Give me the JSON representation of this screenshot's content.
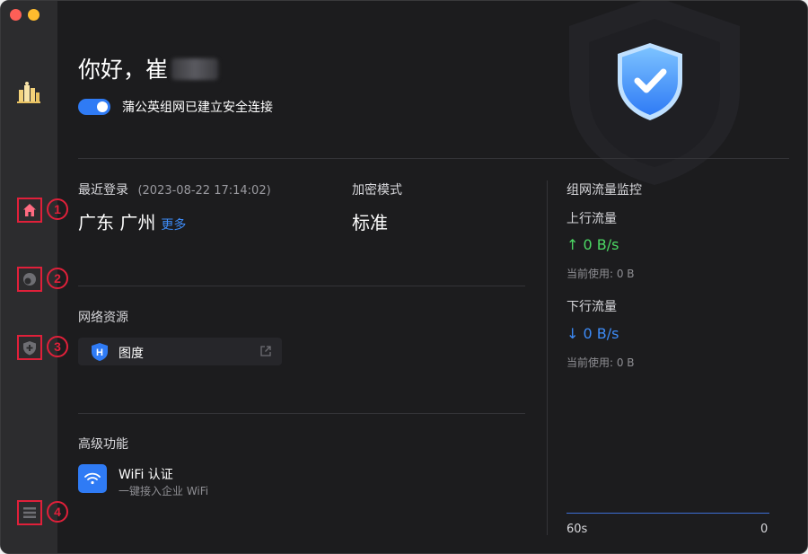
{
  "window": {
    "traffic_lights": [
      "red",
      "yellow"
    ]
  },
  "sidebar": {
    "items": [
      {
        "name": "home",
        "icon": "home-icon",
        "num": "1"
      },
      {
        "name": "network",
        "icon": "globe-icon",
        "num": "2"
      },
      {
        "name": "security",
        "icon": "shield-plus-icon",
        "num": "3"
      },
      {
        "name": "menu",
        "icon": "menu-icon",
        "num": "4"
      }
    ]
  },
  "header": {
    "greeting": "你好，崔",
    "connection_status": "蒲公英组网已建立安全连接",
    "toggle_on": true
  },
  "login": {
    "label": "最近登录",
    "time": "(2023-08-22 17:14:02)",
    "location": "广东 广州",
    "more_link": "更多"
  },
  "encryption": {
    "label": "加密模式",
    "value": "标准"
  },
  "resources": {
    "title": "网络资源",
    "items": [
      {
        "name": "图度",
        "icon": "shield-h-icon"
      }
    ]
  },
  "advanced": {
    "title": "高级功能",
    "items": [
      {
        "title": "WiFi 认证",
        "subtitle": "一键接入企业 WiFi",
        "icon": "wifi-icon"
      }
    ]
  },
  "traffic": {
    "title": "组网流量监控",
    "upload": {
      "label": "上行流量",
      "rate": "↑ 0 B/s",
      "usage": "当前使用: 0 B"
    },
    "download": {
      "label": "下行流量",
      "rate": "↓ 0 B/s",
      "usage": "当前使用: 0 B"
    },
    "axis_left": "60s",
    "axis_right": "0"
  },
  "colors": {
    "accent": "#2f7bf5",
    "upload": "#4cd964",
    "download": "#3d8bf7",
    "annotation": "#e0203a"
  }
}
